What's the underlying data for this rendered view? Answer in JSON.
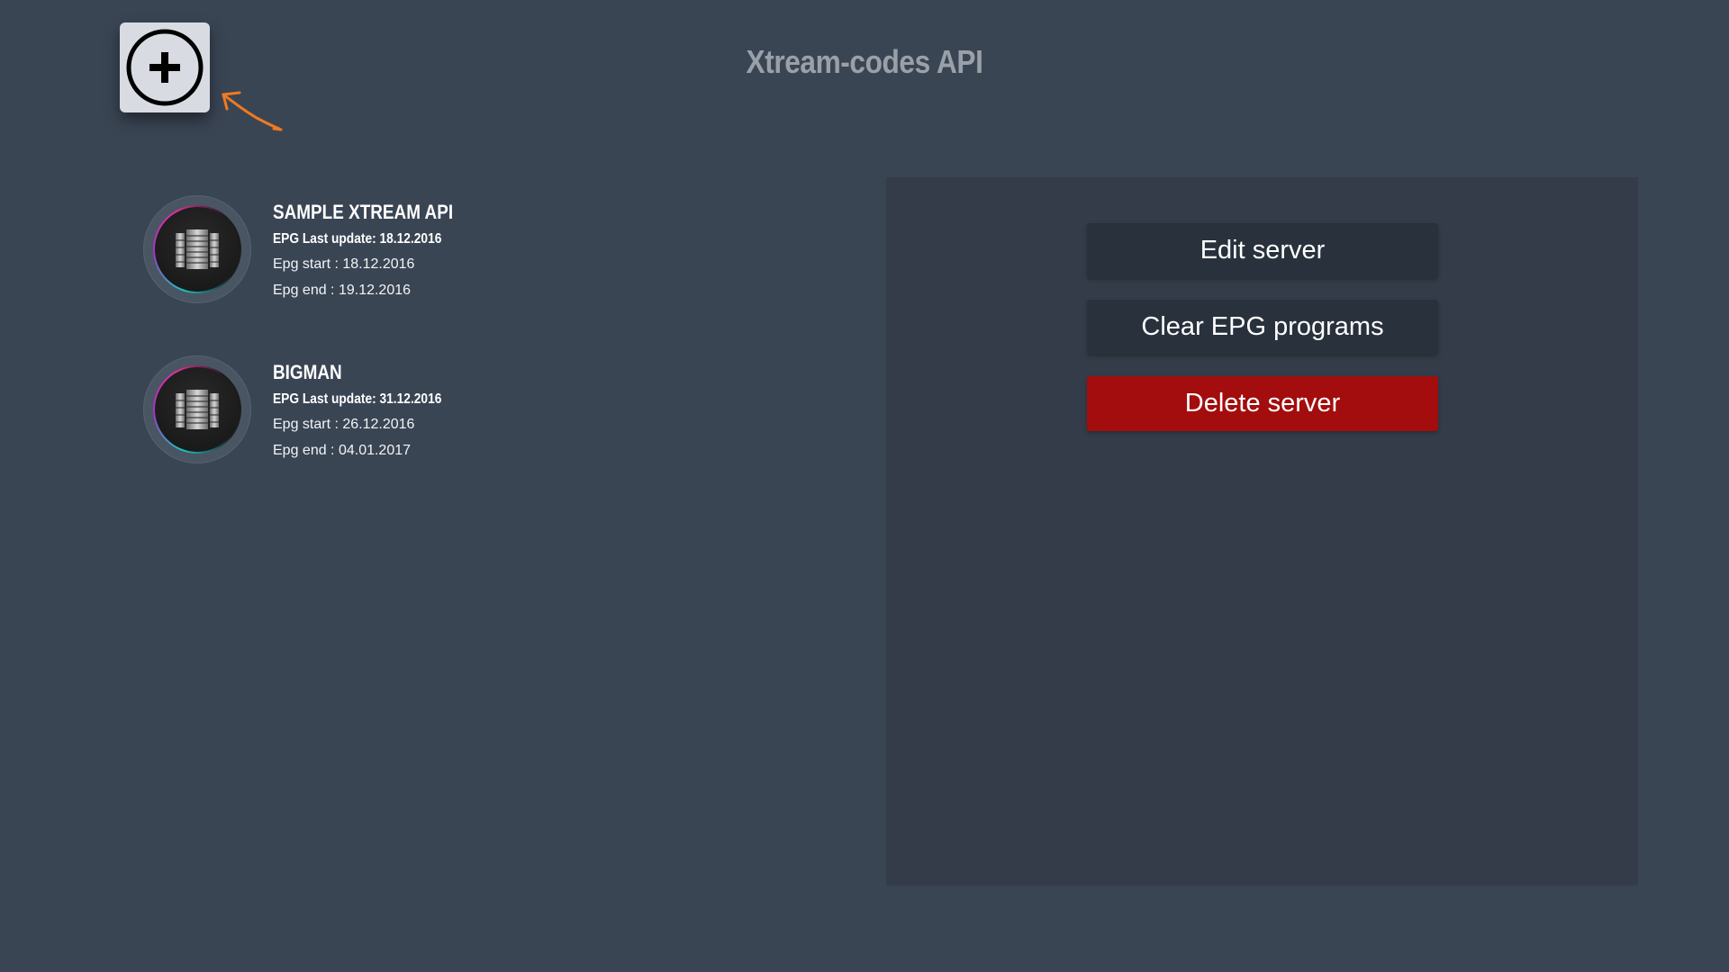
{
  "header": {
    "title": "Xtream-codes API",
    "add_button_icon": "plus-circle-icon",
    "hint_arrow_icon": "arrow-icon",
    "hint_arrow_color": "#f07a20"
  },
  "servers": [
    {
      "name": "SAMPLE XTREAM API",
      "epg_last_update": "EPG Last update: 18.12.2016",
      "epg_start": "Epg start : 18.12.2016",
      "epg_end": "Epg end : 19.12.2016",
      "icon": "server-icon"
    },
    {
      "name": "BIGMAN",
      "epg_last_update": "EPG Last update: 31.12.2016",
      "epg_start": "Epg start : 26.12.2016",
      "epg_end": "Epg end : 04.01.2017",
      "icon": "server-icon"
    }
  ],
  "actions": {
    "edit_label": "Edit server",
    "clear_epg_label": "Clear EPG programs",
    "delete_label": "Delete server"
  },
  "colors": {
    "background": "#3a4554",
    "panel": "#333c48",
    "button": "#28313c",
    "danger": "#a30d0d"
  }
}
